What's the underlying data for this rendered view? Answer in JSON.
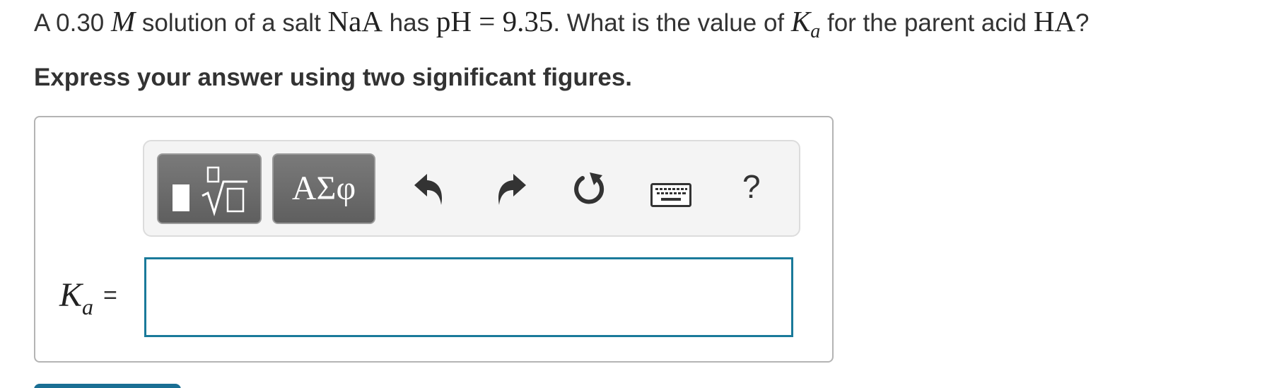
{
  "question": {
    "p1": "A 0.30 ",
    "m_unit": "M",
    "p2": " solution of a salt ",
    "salt": "NaA",
    "p3": " has ",
    "ph_expr": "pH = 9.35",
    "p4": ". What is the value of ",
    "k_symbol": "K",
    "k_sub": "a",
    "p5": " for the parent acid ",
    "acid": "HA",
    "p6": "?"
  },
  "instruction": "Express your answer using two significant figures.",
  "toolbar": {
    "symbols_label": "ΑΣφ",
    "help_label": "?",
    "icons": [
      "templates-icon",
      "undo-icon",
      "redo-icon",
      "reset-icon",
      "keyboard-icon",
      "help-icon"
    ]
  },
  "answer": {
    "label_symbol": "K",
    "label_sub": "a",
    "label_equals": "=",
    "value": ""
  },
  "colors": {
    "accent": "#1a7a9a",
    "toolbar_button": "#6b6b6b",
    "text": "#333333"
  }
}
